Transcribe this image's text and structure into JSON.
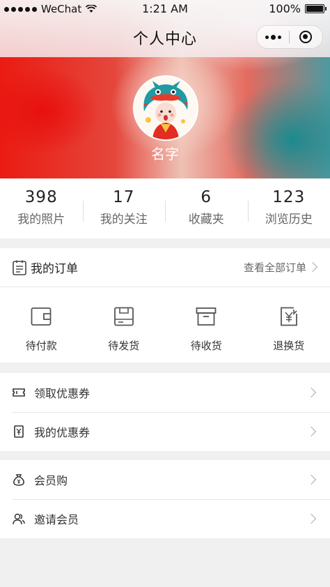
{
  "status_bar": {
    "carrier": "WeChat",
    "time": "1:21 AM",
    "battery": "100%"
  },
  "nav": {
    "title": "个人中心",
    "more_icon": "more-dots-icon",
    "close_icon": "target-circle-icon"
  },
  "profile": {
    "name": "名字",
    "avatar_icon": "dragon-costume-avatar"
  },
  "stats": [
    {
      "value": "398",
      "label": "我的照片"
    },
    {
      "value": "17",
      "label": "我的关注"
    },
    {
      "value": "6",
      "label": "收藏夹"
    },
    {
      "value": "123",
      "label": "浏览历史"
    }
  ],
  "orders": {
    "title": "我的订单",
    "view_all": "查看全部订单",
    "items": [
      {
        "label": "待付款",
        "icon": "wallet-icon"
      },
      {
        "label": "待发货",
        "icon": "package-icon"
      },
      {
        "label": "待收货",
        "icon": "box-icon"
      },
      {
        "label": "退换货",
        "icon": "refund-icon"
      }
    ]
  },
  "coupons": [
    {
      "label": "领取优惠券",
      "icon": "ticket-icon"
    },
    {
      "label": "我的优惠券",
      "icon": "coupon-icon"
    }
  ],
  "members": [
    {
      "label": "会员购",
      "icon": "money-bag-icon"
    },
    {
      "label": "邀请会员",
      "icon": "users-icon"
    }
  ],
  "colors": {
    "hero_red": "#ea1b12",
    "hero_teal": "#1c8a8f",
    "background": "#f0f0f0"
  }
}
